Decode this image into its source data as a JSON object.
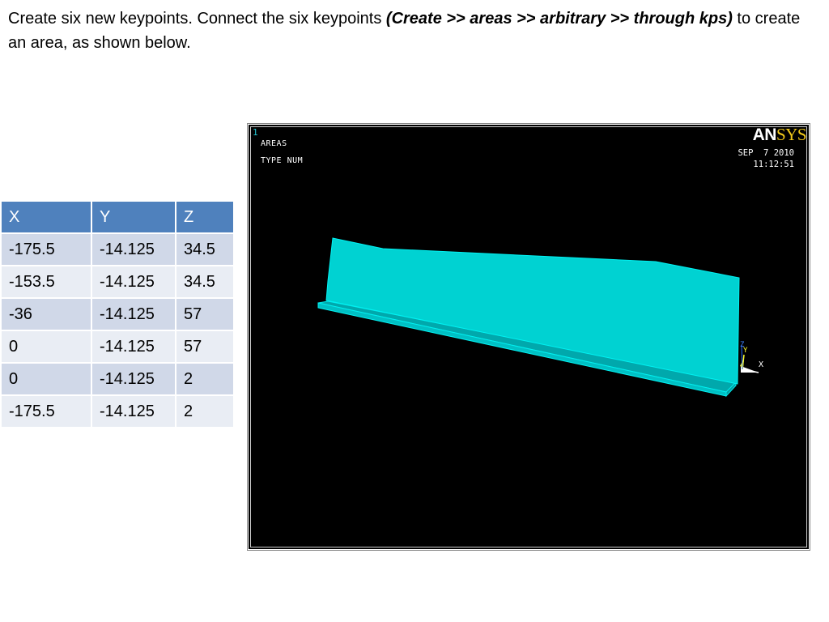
{
  "instructions": {
    "part1": "Create six new keypoints. Connect the six keypoints ",
    "command": "(Create >> areas >> arbitrary >> through kps)",
    "part2": " to create an area, as shown below."
  },
  "keypoint_table": {
    "headers": [
      "X",
      "Y",
      "Z"
    ],
    "rows": [
      [
        "-175.5",
        "-14.125",
        "34.5"
      ],
      [
        "-153.5",
        "-14.125",
        "34.5"
      ],
      [
        "-36",
        "-14.125",
        "57"
      ],
      [
        "0",
        "-14.125",
        "57"
      ],
      [
        "0",
        "-14.125",
        "2"
      ],
      [
        "-175.5",
        "-14.125",
        "2"
      ]
    ]
  },
  "ansys_window": {
    "window_number": "1",
    "plot_label": "AREAS",
    "type_label": "TYPE NUM",
    "logo_an": "AN",
    "logo_sys": "SYS",
    "date": "SEP  7 2010",
    "time": "11:12:51",
    "triad": {
      "x_label": "X",
      "y_label": "Y",
      "z_label": "Z"
    },
    "colors": {
      "background": "#000000",
      "area_fill": "#00d2d2",
      "area_edge": "#00f0f0",
      "logo_sys": "#f2c91a"
    }
  }
}
